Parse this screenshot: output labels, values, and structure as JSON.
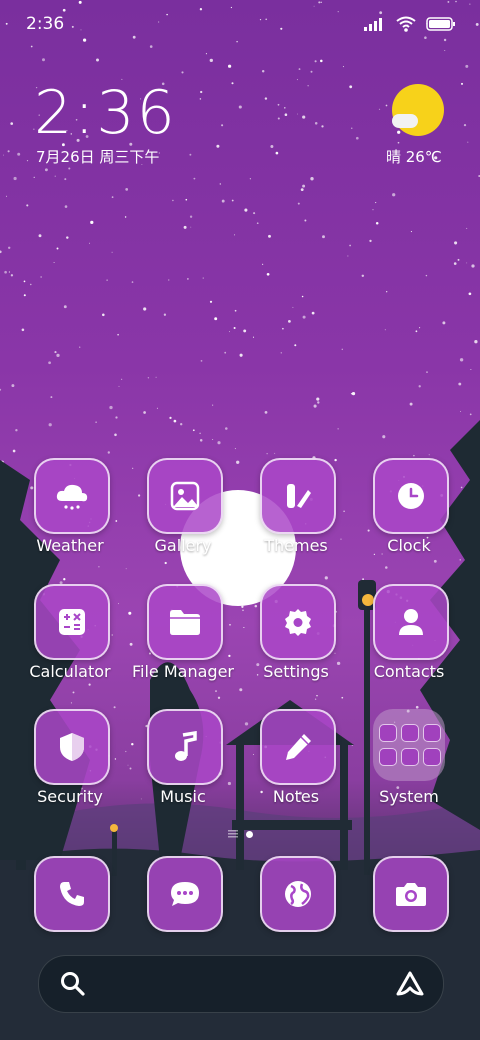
{
  "status_bar": {
    "time": "2:36"
  },
  "lock_widget": {
    "big_time": "2:36",
    "date": "7月26日 周三下午"
  },
  "weather_widget": {
    "text": "晴 26℃"
  },
  "apps": [
    {
      "label": "Weather",
      "icon": "cloud-icon"
    },
    {
      "label": "Gallery",
      "icon": "image-icon"
    },
    {
      "label": "Themes",
      "icon": "brush-icon"
    },
    {
      "label": "Clock",
      "icon": "clock-icon"
    },
    {
      "label": "Calculator",
      "icon": "calculator-icon"
    },
    {
      "label": "File Manager",
      "icon": "folder-icon"
    },
    {
      "label": "Settings",
      "icon": "gear-icon"
    },
    {
      "label": "Contacts",
      "icon": "person-icon"
    },
    {
      "label": "Security",
      "icon": "shield-icon"
    },
    {
      "label": "Music",
      "icon": "music-note-icon"
    },
    {
      "label": "Notes",
      "icon": "pencil-icon"
    },
    {
      "label": "System",
      "icon": "folder-grid-icon"
    }
  ],
  "dock": [
    {
      "icon": "phone-icon"
    },
    {
      "icon": "chat-icon"
    },
    {
      "icon": "globe-icon"
    },
    {
      "icon": "camera-icon"
    }
  ],
  "pager": {
    "pages": 2,
    "current": 2
  },
  "colors": {
    "accent": "#a846c8",
    "sun": "#f7d21a",
    "sky_top": "#7a2f9e",
    "ground": "#1f2a33"
  }
}
